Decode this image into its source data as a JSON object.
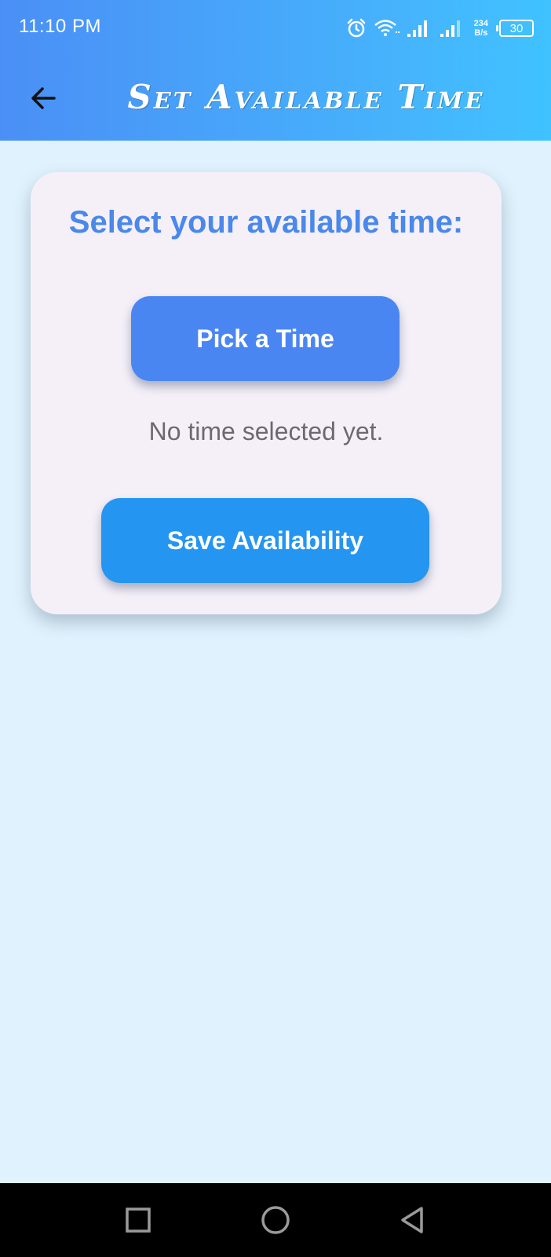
{
  "status_bar": {
    "time": "11:10 PM",
    "net_speed_value": "234",
    "net_speed_unit": "B/s",
    "battery_level": "30",
    "icons": [
      "alarm-icon",
      "wifi-icon",
      "signal-icon",
      "signal-icon",
      "battery-icon"
    ]
  },
  "app_bar": {
    "title": "Set Available Time",
    "back_icon": "arrow-left-icon"
  },
  "card": {
    "heading": "Select your available time:",
    "pick_button_label": "Pick a Time",
    "selection_status": "No time selected yet.",
    "save_button_label": "Save Availability"
  },
  "nav_bar": {
    "icons": [
      "recents-square-icon",
      "home-circle-icon",
      "back-triangle-icon"
    ]
  },
  "colors": {
    "app_bar_gradient_start": "#4a8ff6",
    "app_bar_gradient_end": "#40c2ff",
    "background": "#e0f2fd",
    "card_background": "#f5f0f8",
    "heading": "#4a88ea",
    "pick_button": "#4a86f2",
    "save_button": "#2495f1",
    "status_text": "#6e6870"
  }
}
